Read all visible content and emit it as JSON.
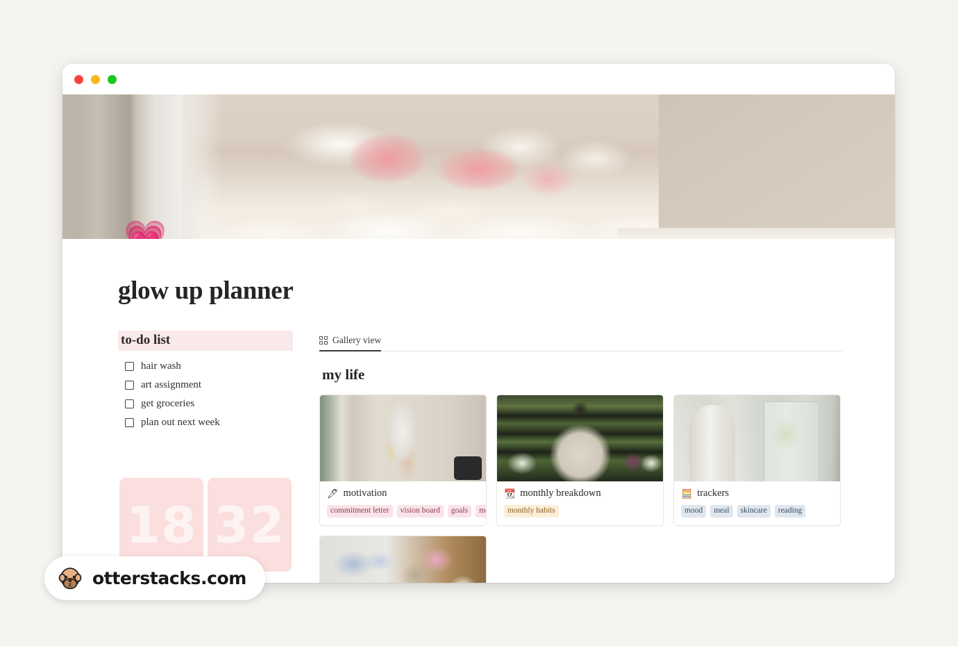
{
  "window": {
    "traffic_lights": [
      {
        "name": "close",
        "color": "#f9453f"
      },
      {
        "name": "minimize",
        "color": "#f7b719"
      },
      {
        "name": "maximize",
        "color": "#1bc81b"
      }
    ]
  },
  "cover": {
    "emoji": "💗",
    "emoji_name": "growing-heart",
    "description": "bed with cream and pink bedding, vase of flowers on nightstand"
  },
  "page": {
    "title": "glow up planner"
  },
  "todo": {
    "heading": "to-do list",
    "heading_highlight": "#fae9ea",
    "items": [
      {
        "label": "hair wash",
        "checked": false
      },
      {
        "label": "art assignment",
        "checked": false
      },
      {
        "label": "get groceries",
        "checked": false
      },
      {
        "label": "plan out next week",
        "checked": false
      }
    ]
  },
  "flip_clock": {
    "digits": [
      "18",
      "32"
    ],
    "panel_color": "#fbdede",
    "digit_color": "#fdf3f3"
  },
  "database": {
    "view_tab": "Gallery view",
    "view_icon": "gallery-grid-icon",
    "title": "my life",
    "cards": [
      {
        "title": "motivation",
        "icon": "pencil-icon",
        "icon_glyph": "🖊",
        "tags": [
          "commitment letter",
          "vision board",
          "goals",
          "me time"
        ],
        "tag_color": "pink",
        "image_alt": "person with hair towel holding a glass drink"
      },
      {
        "title": "monthly breakdown",
        "icon": "calendar-icon",
        "icon_glyph": "📆",
        "tags": [
          "monthly habits"
        ],
        "tag_color": "tan",
        "image_alt": "person shopping in grocery produce aisle"
      },
      {
        "title": "trackers",
        "icon": "abacus-icon",
        "icon_glyph": "🧮",
        "tags": [
          "mood",
          "meal",
          "skincare",
          "reading"
        ],
        "tag_color": "blue",
        "image_alt": "mason jar of cucumber water next to bottle"
      },
      {
        "title": "",
        "icon": "",
        "icon_glyph": "",
        "tags": [],
        "tag_color": "pink",
        "image_alt": "tote bag with laundry and flowers"
      }
    ]
  },
  "watermark": {
    "text": "otterstacks.com",
    "logo": "otter-icon"
  }
}
